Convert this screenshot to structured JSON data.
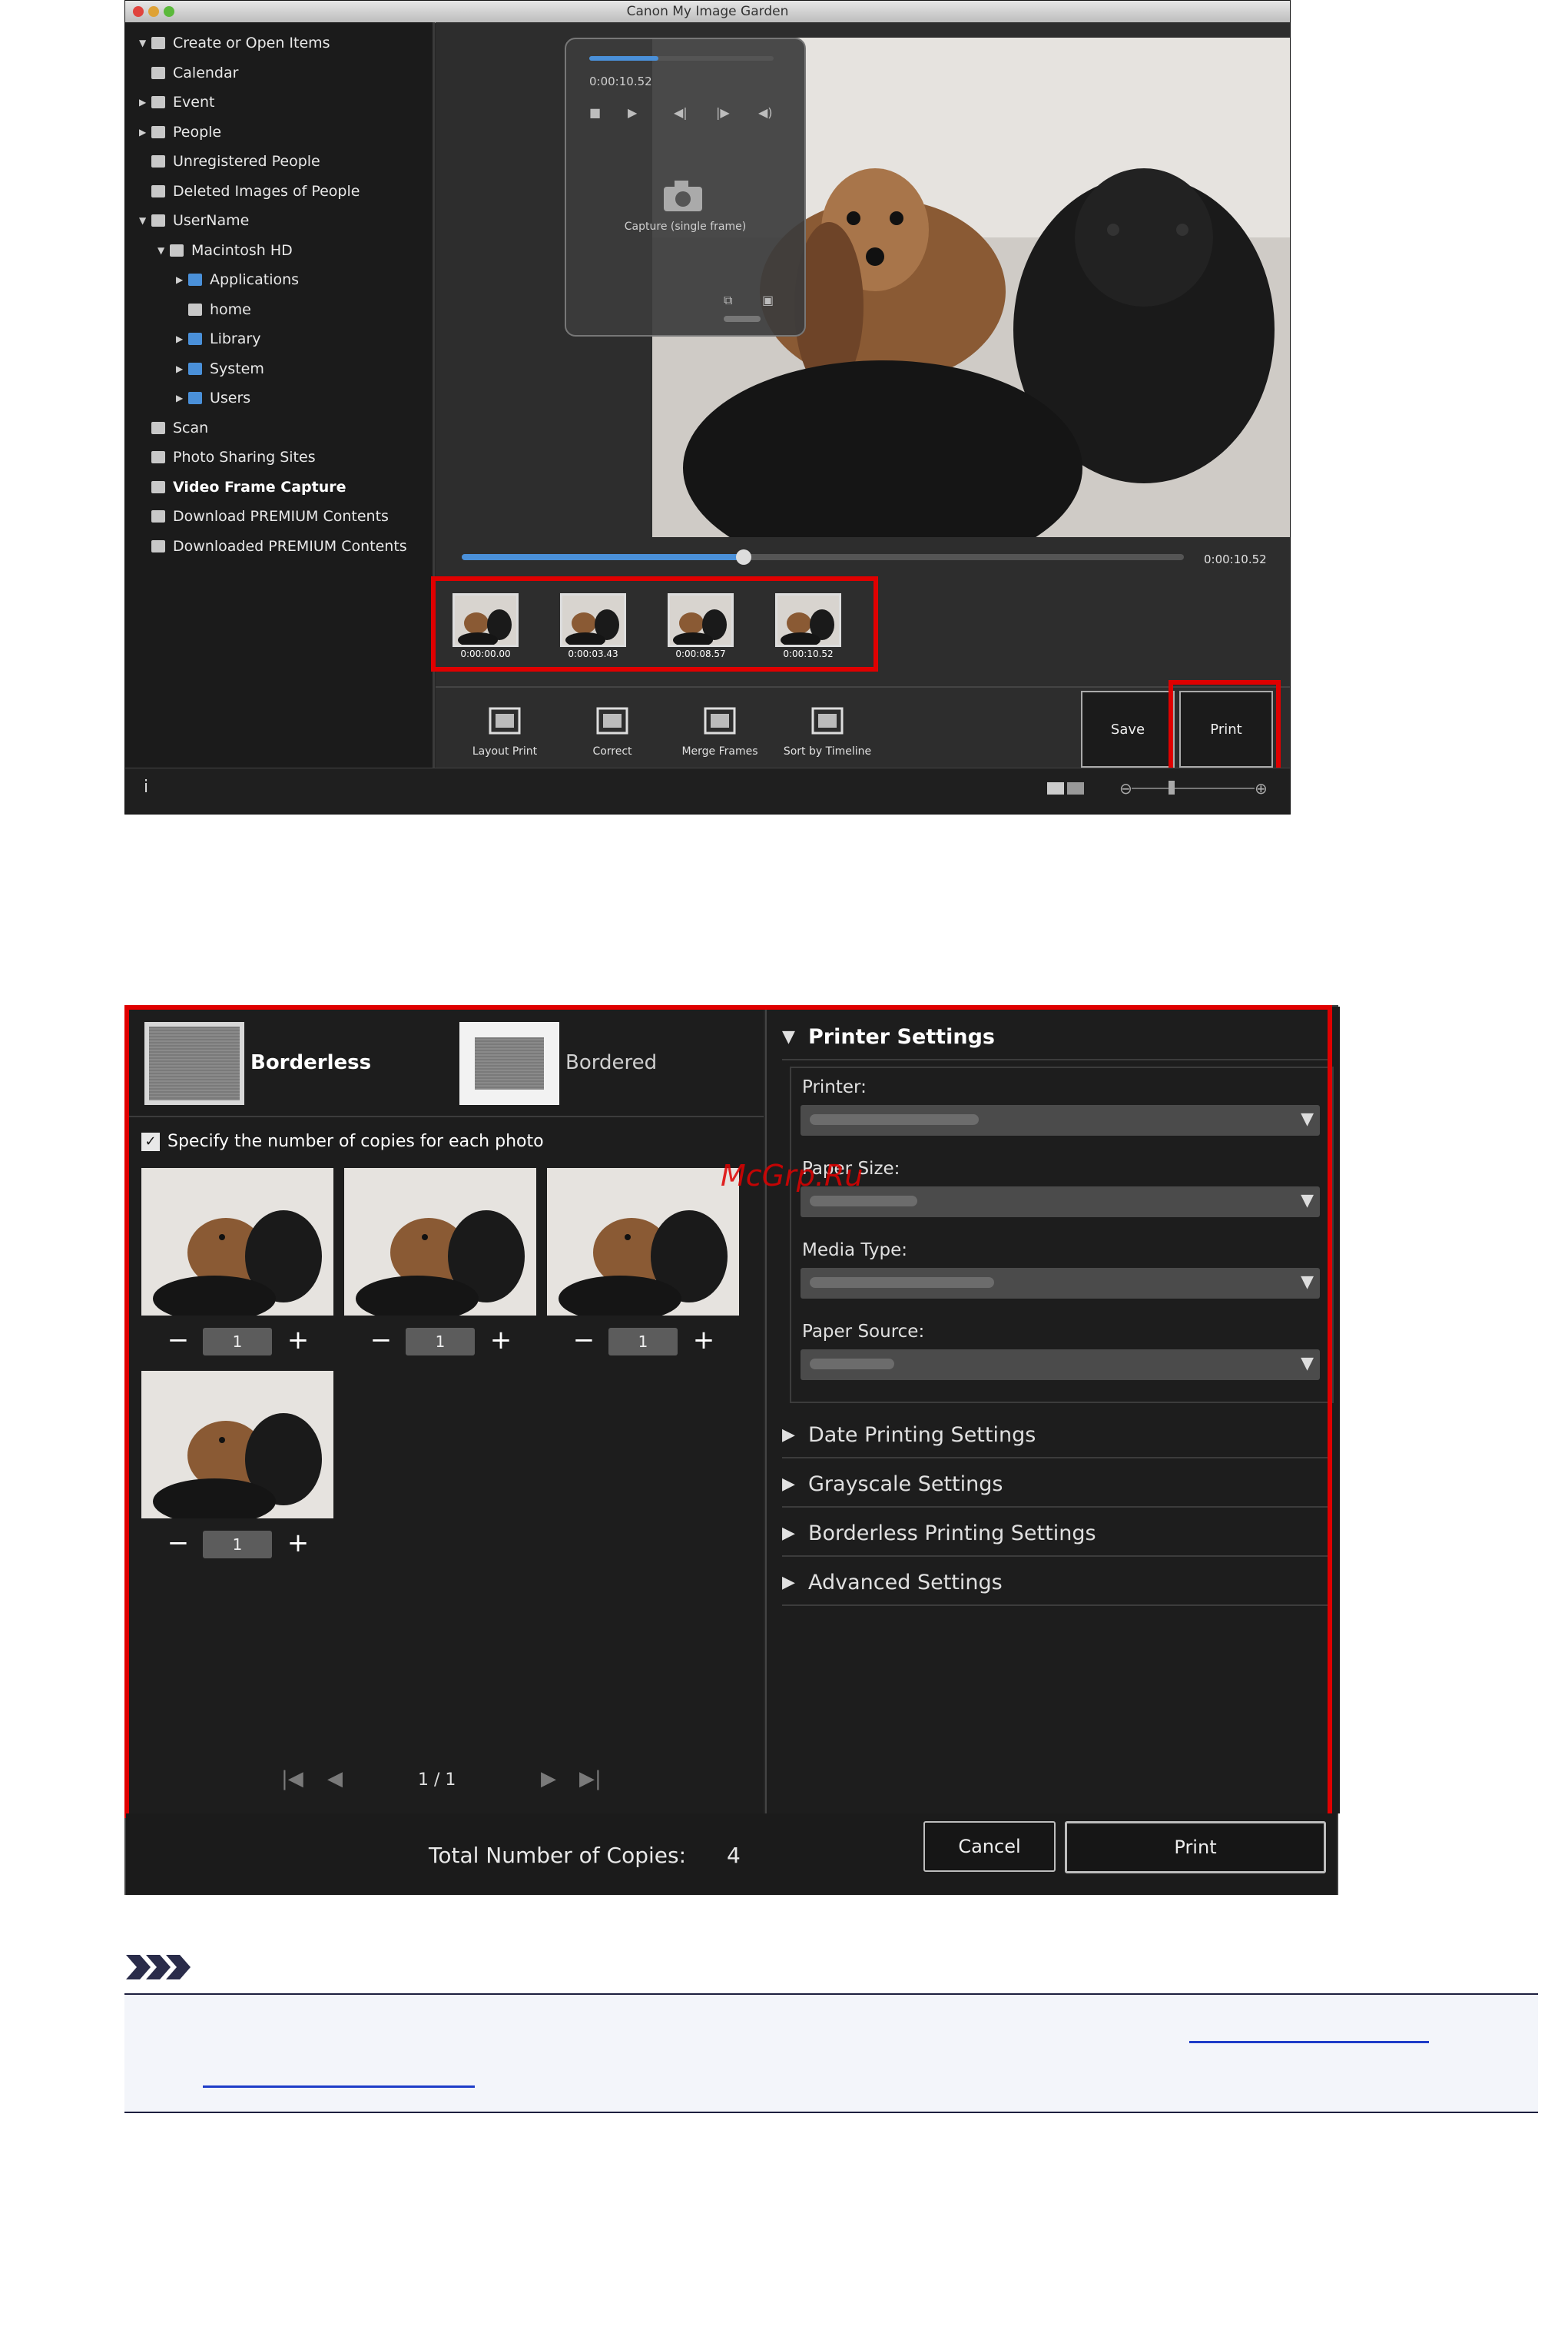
{
  "window1": {
    "title": "Canon My Image Garden",
    "sidebar": [
      {
        "label": "Create or Open Items",
        "indent": 0,
        "arrow": "▼",
        "bold": false
      },
      {
        "label": "Calendar",
        "indent": 0,
        "arrow": "",
        "bold": false
      },
      {
        "label": "Event",
        "indent": 0,
        "arrow": "▶",
        "bold": false
      },
      {
        "label": "People",
        "indent": 0,
        "arrow": "▶",
        "bold": false
      },
      {
        "label": "Unregistered People",
        "indent": 0,
        "arrow": "",
        "bold": false
      },
      {
        "label": "Deleted Images of People",
        "indent": 0,
        "arrow": "",
        "bold": false
      },
      {
        "label": "UserName",
        "indent": 0,
        "arrow": "▼",
        "bold": false
      },
      {
        "label": "Macintosh HD",
        "indent": 1,
        "arrow": "▼",
        "bold": false
      },
      {
        "label": "Applications",
        "indent": 2,
        "arrow": "▶",
        "bold": false,
        "folder": true
      },
      {
        "label": "home",
        "indent": 2,
        "arrow": "",
        "bold": false
      },
      {
        "label": "Library",
        "indent": 2,
        "arrow": "▶",
        "bold": false,
        "folder": true
      },
      {
        "label": "System",
        "indent": 2,
        "arrow": "▶",
        "bold": false,
        "folder": true
      },
      {
        "label": "Users",
        "indent": 2,
        "arrow": "▶",
        "bold": false,
        "folder": true
      },
      {
        "label": "Scan",
        "indent": 0,
        "arrow": "",
        "bold": false
      },
      {
        "label": "Photo Sharing Sites",
        "indent": 0,
        "arrow": "",
        "bold": false
      },
      {
        "label": "Video Frame Capture",
        "indent": 0,
        "arrow": "",
        "bold": true
      },
      {
        "label": "Download PREMIUM Contents",
        "indent": 0,
        "arrow": "",
        "bold": false
      },
      {
        "label": "Downloaded PREMIUM Contents",
        "indent": 0,
        "arrow": "",
        "bold": false
      }
    ],
    "player": {
      "time": "0:00:10.52",
      "capture_label": "Capture (single frame)",
      "progress": 0.39,
      "timeline_time": "0:00:10.52"
    },
    "frames": [
      "0:00:00.00",
      "0:00:03.43",
      "0:00:08.57",
      "0:00:10.52"
    ],
    "tools": [
      "Layout Print",
      "Correct",
      "Merge Frames",
      "Sort by Timeline"
    ],
    "save_label": "Save",
    "print_label": "Print",
    "info_icon": "i"
  },
  "window2": {
    "paper_types": [
      {
        "label": "Borderless",
        "selected": true
      },
      {
        "label": "Bordered",
        "selected": false
      }
    ],
    "copies_check": {
      "label": "Specify the number of copies for each photo",
      "checked": true
    },
    "photos": [
      {
        "copies": "1"
      },
      {
        "copies": "1"
      },
      {
        "copies": "1"
      },
      {
        "copies": "1"
      }
    ],
    "page_indicator": "1 / 1",
    "printer_settings": {
      "title": "Printer Settings",
      "fields": [
        "Printer:",
        "Paper Size:",
        "Media Type:",
        "Paper Source:"
      ]
    },
    "sections": [
      "Date Printing Settings",
      "Grayscale Settings",
      "Borderless Printing Settings",
      "Advanced Settings"
    ],
    "total_label": "Total Number of Copies:",
    "total_value": "4",
    "cancel_label": "Cancel",
    "print_label": "Print"
  },
  "watermark": "McGrp.Ru",
  "note": {
    "icon": "note-icon"
  }
}
